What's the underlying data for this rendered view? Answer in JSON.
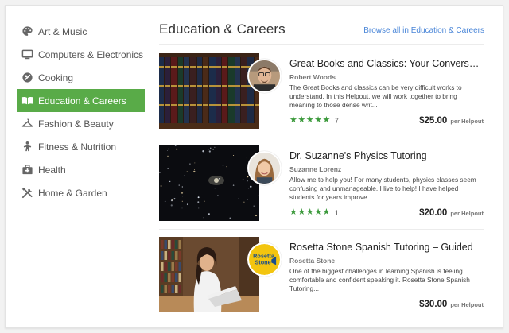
{
  "sidebar": {
    "items": [
      {
        "label": "Art & Music",
        "icon": "palette-icon",
        "active": false
      },
      {
        "label": "Computers & Electronics",
        "icon": "monitor-icon",
        "active": false
      },
      {
        "label": "Cooking",
        "icon": "cooking-icon",
        "active": false
      },
      {
        "label": "Education & Careers",
        "icon": "book-icon",
        "active": true
      },
      {
        "label": "Fashion & Beauty",
        "icon": "hanger-icon",
        "active": false
      },
      {
        "label": "Fitness & Nutrition",
        "icon": "fitness-icon",
        "active": false
      },
      {
        "label": "Health",
        "icon": "medical-kit-icon",
        "active": false
      },
      {
        "label": "Home & Garden",
        "icon": "tools-icon",
        "active": false
      }
    ]
  },
  "header": {
    "title": "Education & Careers",
    "browse_link": "Browse all in Education & Careers"
  },
  "listings": [
    {
      "title": "Great Books and Classics: Your Conversational ...",
      "author": "Robert Woods",
      "description": "The Great Books and classics can be very difficult works to understand. In this Helpout, we will work together to bring meaning to those dense writ...",
      "rating": 5,
      "review_count": "7",
      "price": "$25.00",
      "price_unit": "per Helpout",
      "thumb": "bookshelf-image",
      "avatar": "person-avatar-man"
    },
    {
      "title": "Dr. Suzanne's Physics Tutoring",
      "author": "Suzanne Lorenz",
      "description": "Allow me to help you! For many students, physics classes seem confusing and unmanageable. I live to help! I have helped students for years improve ...",
      "rating": 5,
      "review_count": "1",
      "price": "$20.00",
      "price_unit": "per Helpout",
      "thumb": "galaxy-image",
      "avatar": "person-avatar-woman"
    },
    {
      "title": "Rosetta Stone Spanish Tutoring – Guided",
      "author": "Rosetta Stone",
      "description": "One of the biggest challenges in learning Spanish is feeling comfortable and confident speaking it. Rosetta Stone Spanish Tutoring...",
      "rating": null,
      "review_count": "",
      "price": "$30.00",
      "price_unit": "per Helpout",
      "thumb": "student-laptop-image",
      "avatar": "rosetta-stone-logo",
      "logo_text": "Rosetta Stone"
    }
  ],
  "colors": {
    "accent_green": "#59ab48",
    "link_blue": "#4a86d8",
    "star_green": "#3c9a3c"
  }
}
